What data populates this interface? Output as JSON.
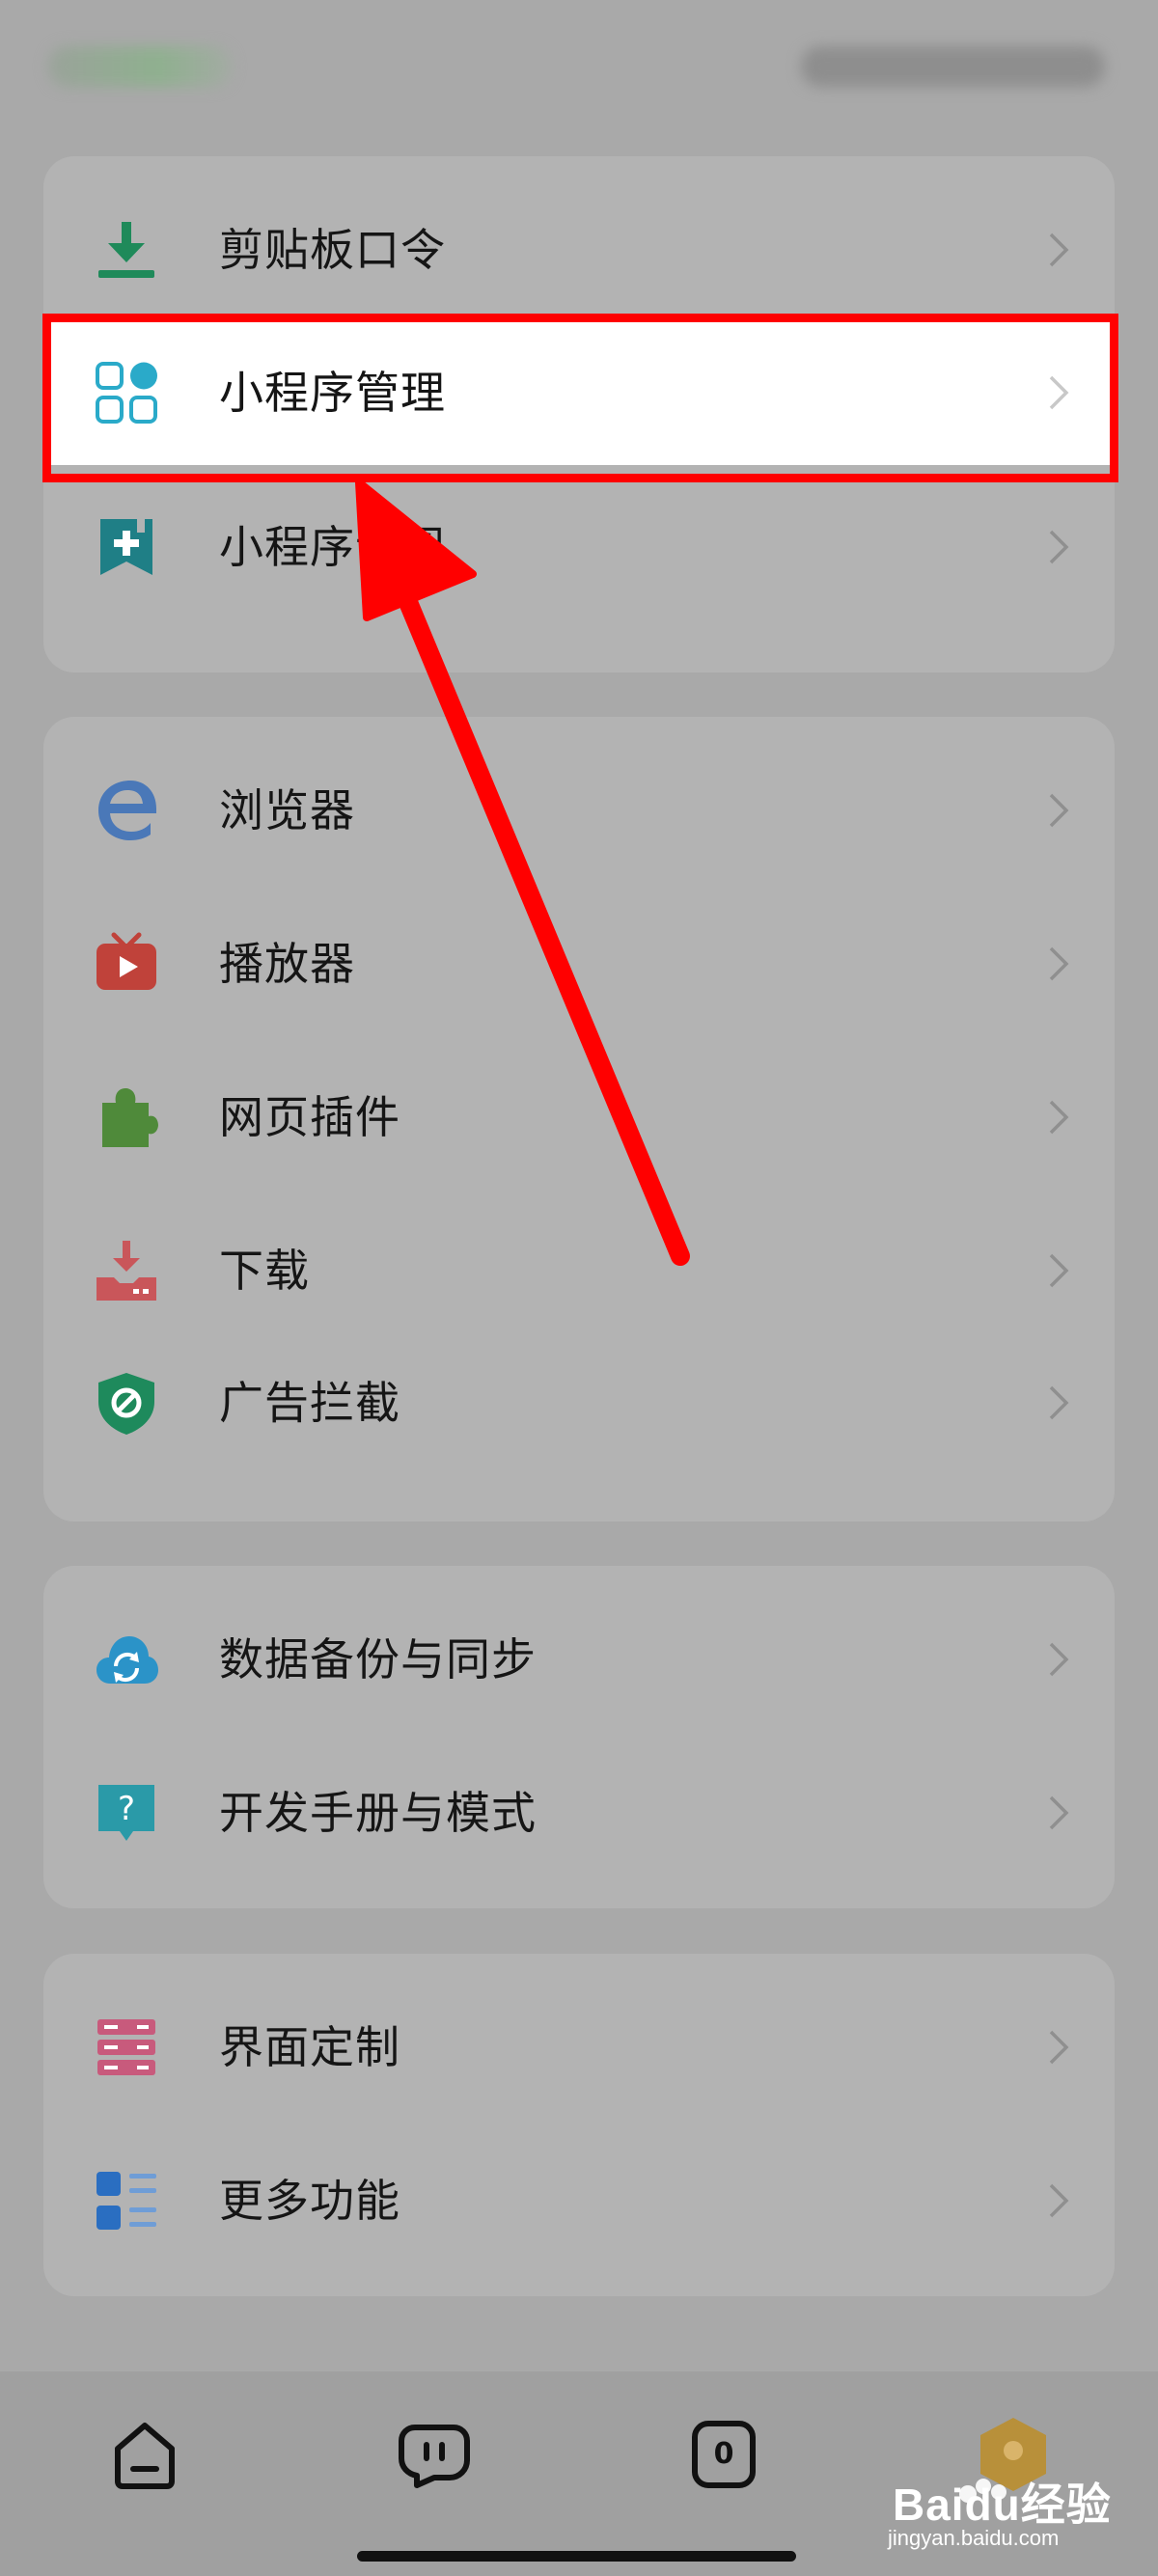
{
  "sections": [
    {
      "items": [
        {
          "label": "剪贴板口令",
          "icon": "clipboard-download-icon",
          "color": "#1f8a5a"
        },
        {
          "label": "小程序管理",
          "icon": "mini-program-grid-icon",
          "color": "#2aaac9"
        },
        {
          "label": "小程序订阅",
          "icon": "bookmark-plus-icon",
          "color": "#1f7f86"
        }
      ]
    },
    {
      "items": [
        {
          "label": "浏览器",
          "icon": "browser-e-icon",
          "color": "#4a78b8"
        },
        {
          "label": "播放器",
          "icon": "tv-player-icon",
          "color": "#c0423a"
        },
        {
          "label": "网页插件",
          "icon": "puzzle-icon",
          "color": "#4f8a3a"
        },
        {
          "label": "下载",
          "icon": "download-icon",
          "color": "#c9565a"
        },
        {
          "label": "广告拦截",
          "icon": "shield-block-icon",
          "color": "#1e8a5c"
        }
      ]
    },
    {
      "items": [
        {
          "label": "数据备份与同步",
          "icon": "cloud-sync-icon",
          "color": "#2b93c8"
        },
        {
          "label": "开发手册与模式",
          "icon": "help-bubble-icon",
          "color": "#2a9aa8"
        }
      ]
    },
    {
      "items": [
        {
          "label": "界面定制",
          "icon": "layout-custom-icon",
          "color": "#c85a7c"
        },
        {
          "label": "更多功能",
          "icon": "more-list-icon",
          "color": "#2a6ec1"
        }
      ]
    }
  ],
  "highlighted_item": "小程序管理",
  "bottom_nav": [
    {
      "icon": "home-icon"
    },
    {
      "icon": "chat-bubble-icon"
    },
    {
      "icon": "tabs-count-icon",
      "count": "0"
    },
    {
      "icon": "profile-hexagon-icon"
    }
  ],
  "watermark": {
    "brand": "Baidu经验",
    "url": "jingyan.baidu.com"
  },
  "colors": {
    "background": "#a9a9a9",
    "card": "#b3b3b3",
    "highlight_border": "#ff0000",
    "arrow": "#ff0000"
  }
}
